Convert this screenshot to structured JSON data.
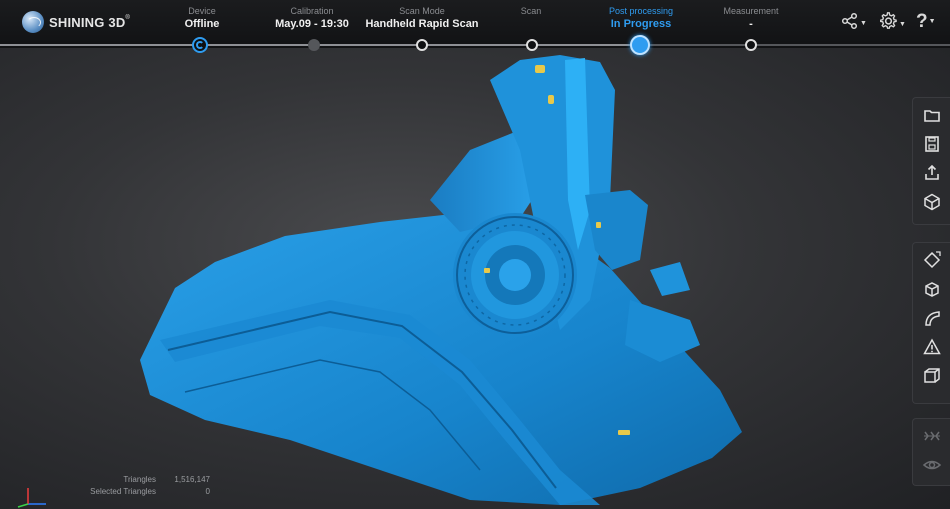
{
  "brand": {
    "name": "SHINING 3D",
    "trademark": "®"
  },
  "workflow": [
    {
      "label": "Device",
      "value": "Offline"
    },
    {
      "label": "Calibration",
      "value": "May.09 - 19:30"
    },
    {
      "label": "Scan Mode",
      "value": "Handheld Rapid Scan"
    },
    {
      "label": "Scan",
      "value": ""
    },
    {
      "label": "Post processing",
      "value": "In Progress",
      "active": true
    },
    {
      "label": "Measurement",
      "value": "-"
    }
  ],
  "top_tools": [
    {
      "icon": "share-icon"
    },
    {
      "icon": "gear-icon"
    },
    {
      "icon": "help-icon",
      "glyph": "?"
    }
  ],
  "file_tools": [
    "folder-icon",
    "save-icon",
    "export-icon",
    "package-icon"
  ],
  "edit_tools": [
    "rotate-cube-icon",
    "box-select-icon",
    "curve-icon",
    "mesh-warning-icon",
    "wireframe-cube-icon"
  ],
  "view_tools": [
    "flip-icon",
    "eye-icon"
  ],
  "stats": {
    "triangles_label": "Triangles",
    "triangles_value": "1,516,147",
    "selected_label": "Selected Triangles",
    "selected_value": "0"
  },
  "colors": {
    "accent": "#2f9cf0",
    "mesh": "#1f8fd6",
    "highlight": "#e8c94a"
  }
}
